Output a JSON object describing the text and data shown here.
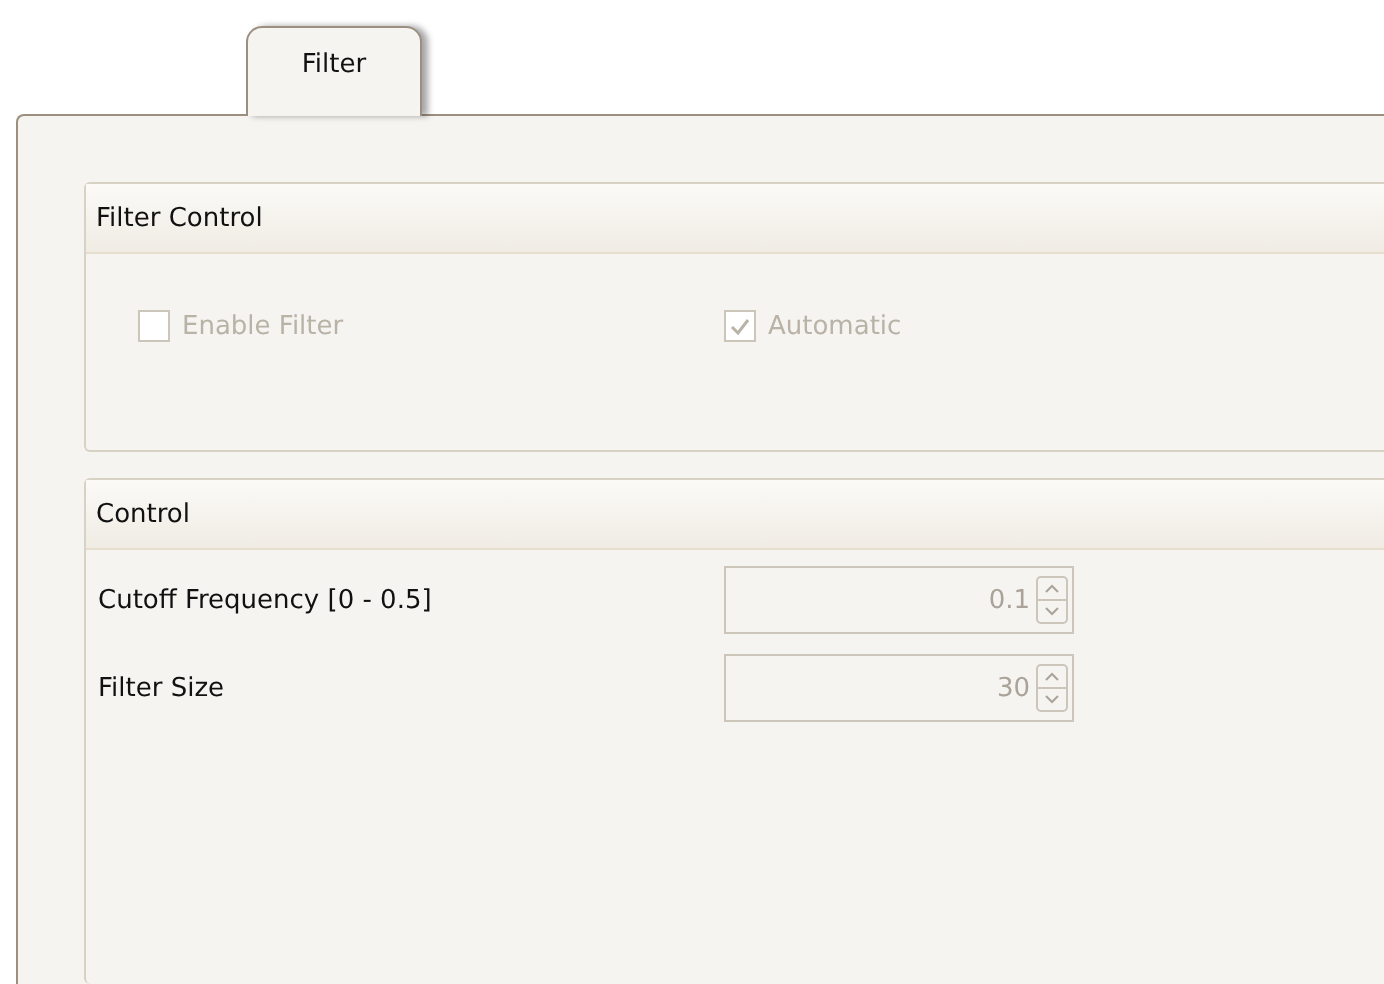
{
  "tabs": [
    {
      "label": "Filter",
      "selected": true
    }
  ],
  "filter_control": {
    "title": "Filter Control",
    "checkboxes": [
      {
        "label": "Enable Filter",
        "checked": false,
        "disabled": true
      },
      {
        "label": "Automatic",
        "checked": true,
        "disabled": true
      }
    ]
  },
  "control": {
    "title": "Control",
    "fields": [
      {
        "label": "Cutoff Frequency  [0 - 0.5]",
        "value": "0.1",
        "disabled": true
      },
      {
        "label": "Filter Size",
        "value": "30",
        "disabled": true
      }
    ]
  }
}
